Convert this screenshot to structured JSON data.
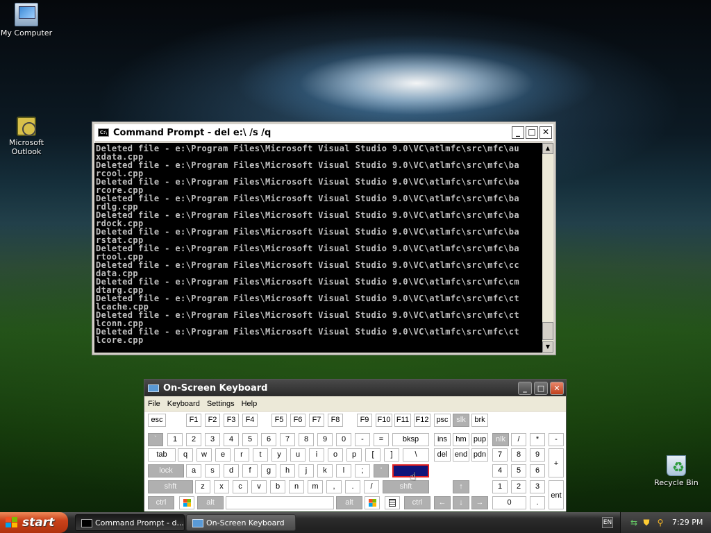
{
  "desktop": {
    "icons": [
      {
        "label": "My Computer",
        "icon": "my-computer-icon"
      },
      {
        "label": "Microsoft Outlook",
        "icon": "outlook-icon"
      },
      {
        "label": "Recycle Bin",
        "icon": "recycle-bin-icon"
      }
    ]
  },
  "cmd": {
    "title": "Command Prompt - del e:\\ /s /q",
    "buttons": {
      "minimize": "_",
      "maximize": "□",
      "close": "✕"
    },
    "lines": [
      "Deleted file - e:\\Program Files\\Microsoft Visual Studio 9.0\\VC\\atlmfc\\src\\mfc\\au",
      "xdata.cpp",
      "Deleted file - e:\\Program Files\\Microsoft Visual Studio 9.0\\VC\\atlmfc\\src\\mfc\\ba",
      "rcool.cpp",
      "Deleted file - e:\\Program Files\\Microsoft Visual Studio 9.0\\VC\\atlmfc\\src\\mfc\\ba",
      "rcore.cpp",
      "Deleted file - e:\\Program Files\\Microsoft Visual Studio 9.0\\VC\\atlmfc\\src\\mfc\\ba",
      "rdlg.cpp",
      "Deleted file - e:\\Program Files\\Microsoft Visual Studio 9.0\\VC\\atlmfc\\src\\mfc\\ba",
      "rdock.cpp",
      "Deleted file - e:\\Program Files\\Microsoft Visual Studio 9.0\\VC\\atlmfc\\src\\mfc\\ba",
      "rstat.cpp",
      "Deleted file - e:\\Program Files\\Microsoft Visual Studio 9.0\\VC\\atlmfc\\src\\mfc\\ba",
      "rtool.cpp",
      "Deleted file - e:\\Program Files\\Microsoft Visual Studio 9.0\\VC\\atlmfc\\src\\mfc\\cc",
      "data.cpp",
      "Deleted file - e:\\Program Files\\Microsoft Visual Studio 9.0\\VC\\atlmfc\\src\\mfc\\cm",
      "dtarg.cpp",
      "Deleted file - e:\\Program Files\\Microsoft Visual Studio 9.0\\VC\\atlmfc\\src\\mfc\\ct",
      "lcache.cpp",
      "Deleted file - e:\\Program Files\\Microsoft Visual Studio 9.0\\VC\\atlmfc\\src\\mfc\\ct",
      "lconn.cpp",
      "Deleted file - e:\\Program Files\\Microsoft Visual Studio 9.0\\VC\\atlmfc\\src\\mfc\\ct",
      "lcore.cpp"
    ]
  },
  "osk": {
    "title": "On-Screen Keyboard",
    "menu": [
      "File",
      "Keyboard",
      "Settings",
      "Help"
    ],
    "selected_key": "enter",
    "keys": {
      "esc": "esc",
      "f1": "F1",
      "f2": "F2",
      "f3": "F3",
      "f4": "F4",
      "f5": "F5",
      "f6": "F6",
      "f7": "F7",
      "f8": "F8",
      "f9": "F9",
      "f10": "F10",
      "f11": "F11",
      "f12": "F12",
      "psc": "psc",
      "slk": "slk",
      "brk": "brk",
      "grave": "`",
      "d1": "1",
      "d2": "2",
      "d3": "3",
      "d4": "4",
      "d5": "5",
      "d6": "6",
      "d7": "7",
      "d8": "8",
      "d9": "9",
      "d0": "0",
      "minus": "-",
      "equals": "=",
      "bksp": "bksp",
      "ins": "ins",
      "hm": "hm",
      "pup": "pup",
      "nlk": "nlk",
      "npslash": "/",
      "npstar": "*",
      "npminus": "-",
      "tab": "tab",
      "q": "q",
      "w": "w",
      "e": "e",
      "r": "r",
      "t": "t",
      "y": "y",
      "u": "u",
      "i": "i",
      "o": "o",
      "p": "p",
      "lbr": "[",
      "rbr": "]",
      "bslash": "\\",
      "del": "del",
      "end": "end",
      "pdn": "pdn",
      "n7": "7",
      "n8": "8",
      "n9": "9",
      "npplus": "+",
      "lock": "lock",
      "a": "a",
      "s": "s",
      "d": "d",
      "f": "f",
      "g": "g",
      "h": "h",
      "j": "j",
      "k": "k",
      "l": "l",
      "semi": ";",
      "quote": "'",
      "enter": "",
      "n4": "4",
      "n5": "5",
      "n6": "6",
      "lshft": "shft",
      "z": "z",
      "x": "x",
      "c": "c",
      "v": "v",
      "b": "b",
      "n": "n",
      "m": "m",
      "comma": ",",
      "period": ".",
      "slash": "/",
      "rshft": "shft",
      "up": "↑",
      "n1": "1",
      "n2": "2",
      "n3": "3",
      "npent": "ent",
      "lctrl": "ctrl",
      "lalt": "alt",
      "space": "",
      "ralt": "alt",
      "rctrl": "ctrl",
      "left": "←",
      "down": "↓",
      "right": "→",
      "n0": "0",
      "npdot": "."
    }
  },
  "taskbar": {
    "start_label": "start",
    "tasks": [
      {
        "label": "Command Prompt - d...",
        "icon": "command-prompt-icon",
        "active": true
      },
      {
        "label": "On-Screen Keyboard",
        "icon": "keyboard-icon",
        "active": false
      }
    ],
    "language": "EN",
    "tray_icons": [
      "network-icon",
      "security-shield-icon",
      "search-icon"
    ],
    "clock": "7:29 PM"
  }
}
